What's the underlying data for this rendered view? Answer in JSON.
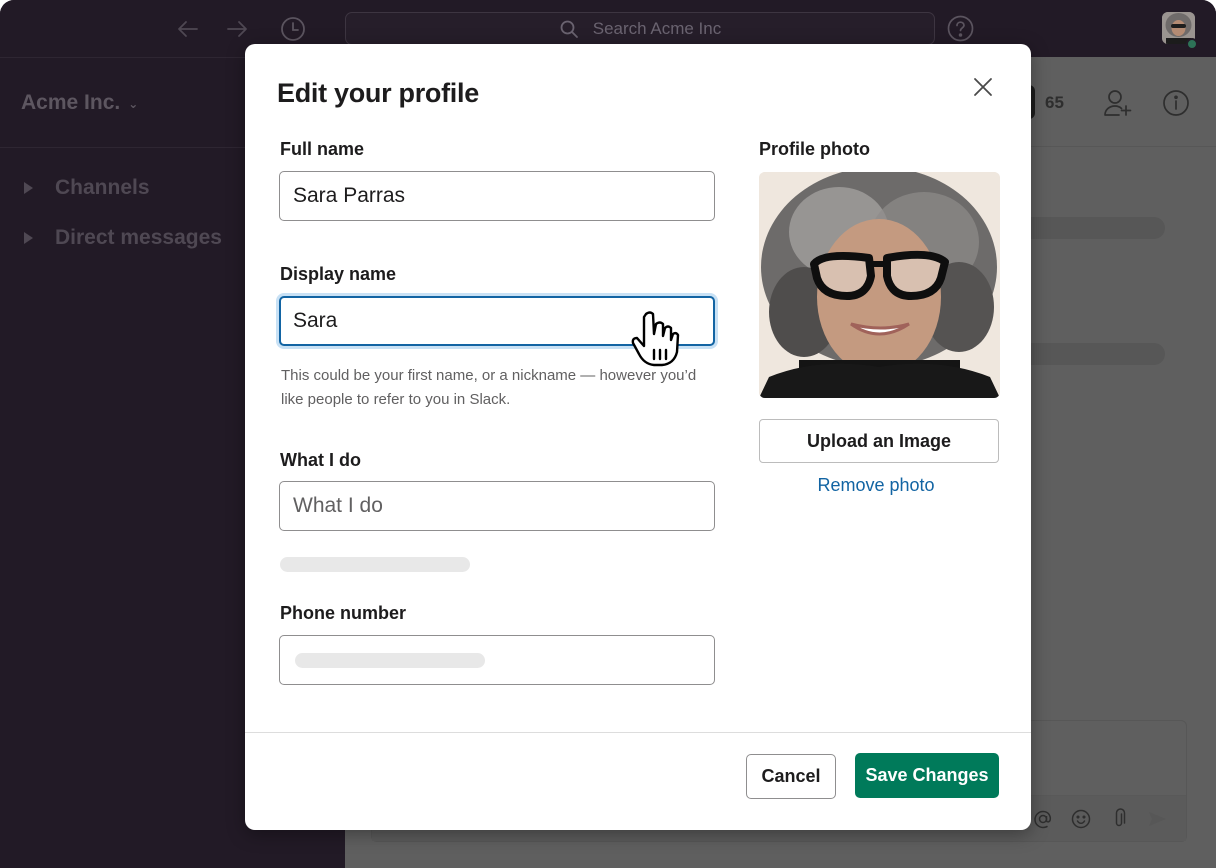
{
  "topbar": {
    "search_placeholder": "Search Acme Inc",
    "icons": [
      "back-arrow-icon",
      "forward-arrow-icon",
      "history-clock-icon",
      "search-icon",
      "help-icon",
      "user-avatar"
    ]
  },
  "sidebar": {
    "workspace_name": "Acme Inc.",
    "items": [
      {
        "label": "Channels"
      },
      {
        "label": "Direct messages"
      }
    ]
  },
  "channel_header": {
    "member_count": "65"
  },
  "modal": {
    "title": "Edit your profile",
    "fields": {
      "full_name": {
        "label": "Full name",
        "value": "Sara Parras"
      },
      "display_name": {
        "label": "Display name",
        "value": "Sara",
        "hint": "This could be your first name, or a nickname — however you’d like people to refer to you in Slack."
      },
      "what_i_do": {
        "label": "What I do",
        "value": "",
        "placeholder": "What I do"
      },
      "phone_number": {
        "label": "Phone number"
      }
    },
    "photo": {
      "label": "Profile photo",
      "upload_label": "Upload an Image",
      "remove_label": "Remove photo"
    },
    "footer": {
      "cancel_label": "Cancel",
      "save_label": "Save Changes"
    }
  },
  "colors": {
    "aubergine": "#221a26",
    "primary_green": "#007a5a",
    "link_blue": "#1264a3",
    "presence_green": "#2d7357"
  }
}
